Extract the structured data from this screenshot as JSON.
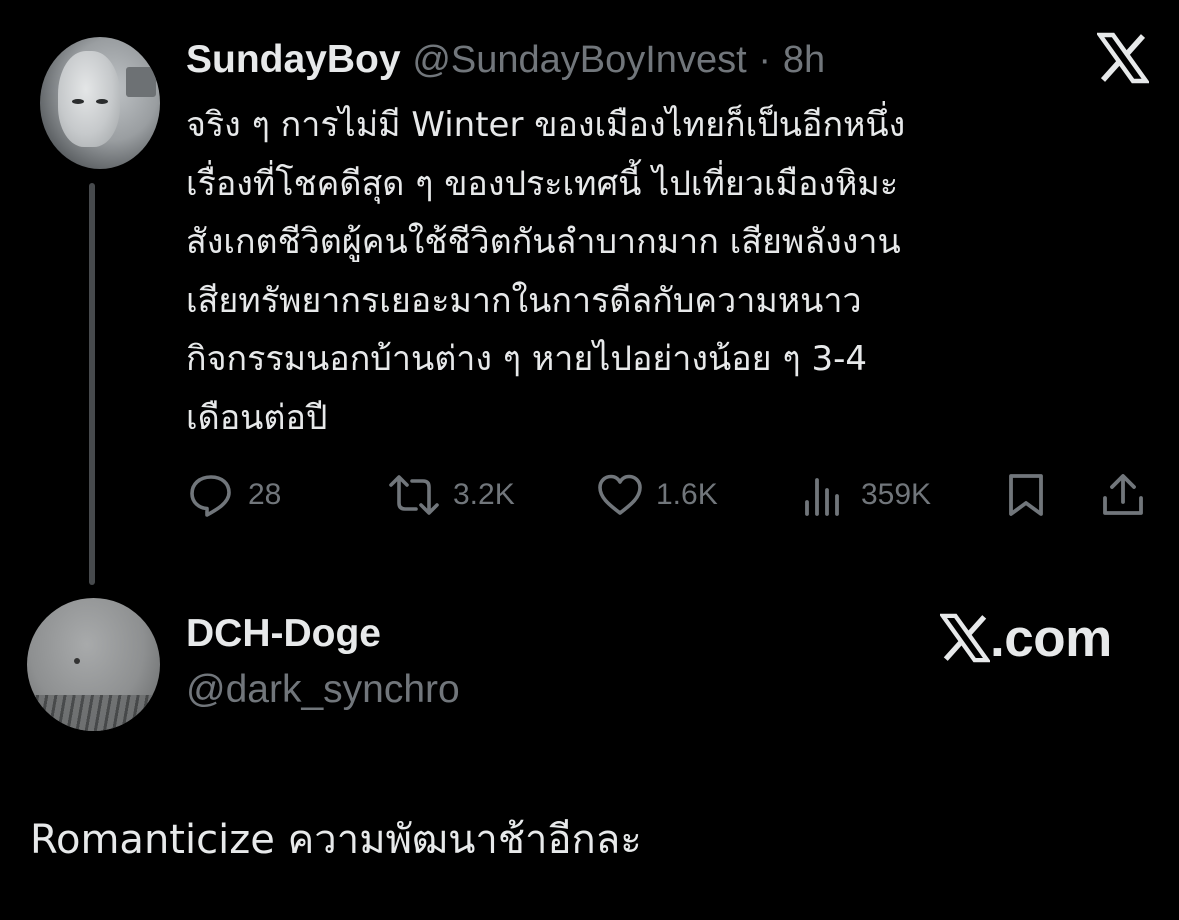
{
  "tweet": {
    "display_name": "SundayBoy",
    "handle": "@SundayBoyInvest",
    "separator": "·",
    "time": "8h",
    "lines": [
      "จริง ๆ การไม่มี Winter ของเมืองไทยก็เป็นอีกหนึ่ง",
      "เรื่องที่โชคดีสุด ๆ ของประเทศนี้ ไปเที่ยวเมืองหิมะ",
      "สังเกตชีวิตผู้คนใช้ชีวิตกันลำบากมาก เสียพลังงาน",
      "เสียทรัพยากรเยอะมากในการดีลกับความหนาว",
      "กิจกรรมนอกบ้านต่าง ๆ หายไปอย่างน้อย ๆ 3-4",
      "เดือนต่อปี"
    ],
    "stats": {
      "replies": "28",
      "reposts": "3.2K",
      "likes": "1.6K",
      "views": "359K"
    },
    "icons": {
      "platform": "x-logo-icon",
      "reply": "reply-icon",
      "repost": "repost-icon",
      "like": "heart-icon",
      "views": "views-icon",
      "bookmark": "bookmark-icon",
      "share": "share-icon"
    }
  },
  "reply": {
    "display_name": "DCH-Doge",
    "handle": "@dark_synchro",
    "watermark": ".com",
    "text": "Romanticize ความพัฒนาช้าอีกละ"
  },
  "colors": {
    "background": "#000000",
    "primary_text": "#e7e9ea",
    "secondary_text": "#71767b",
    "thread_line": "#474a4d"
  }
}
